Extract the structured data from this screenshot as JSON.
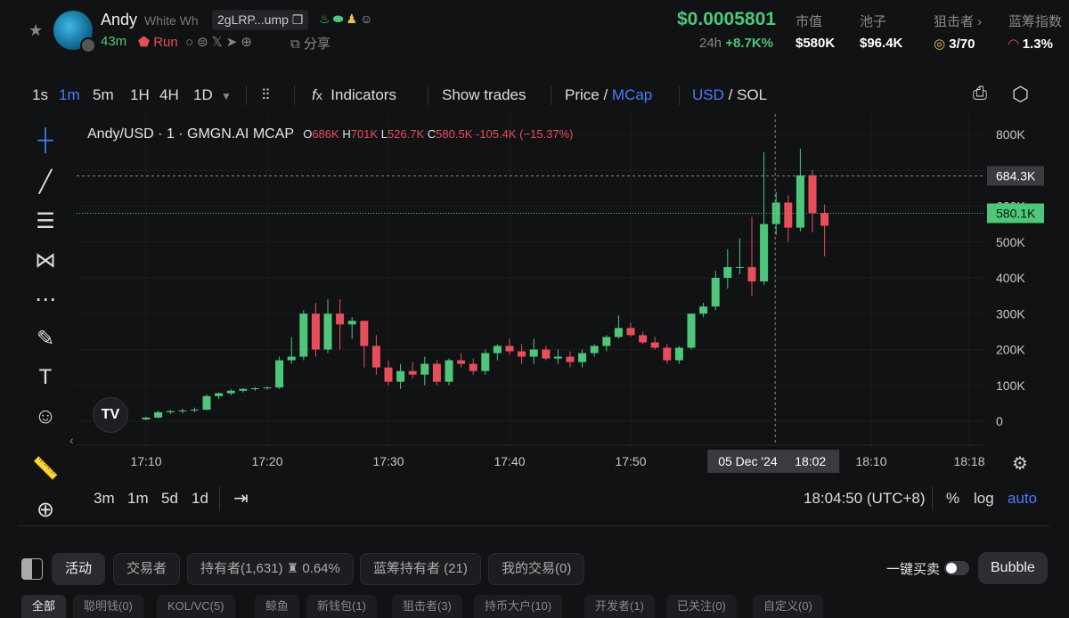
{
  "token": {
    "name": "Andy",
    "subname": "White Wh",
    "address": "2gLRP...ump",
    "age": "43m",
    "run_label": "Run",
    "share_label": "分享",
    "price": "$0.0005801",
    "change_24h_label": "24h",
    "change_24h": "+8.7K%"
  },
  "stats": [
    {
      "label": "市值",
      "value": "$580K"
    },
    {
      "label": "池子",
      "value": "$96.4K"
    },
    {
      "label": "狙击者 ›",
      "value": "3/70"
    },
    {
      "label": "蓝筹指数",
      "value": "1.3%"
    }
  ],
  "toolbar": {
    "intervals": [
      "1s",
      "1m",
      "5m",
      "1H",
      "4H",
      "1D"
    ],
    "active_interval": "1m",
    "indicators_label": "Indicators",
    "show_trades_label": "Show trades",
    "price_label": "Price",
    "mcap_label": "MCap",
    "usd_label": "USD",
    "sol_label": "SOL"
  },
  "chart_legend": {
    "symbol": "Andy/USD · 1 · GMGN.AI MCAP",
    "o_label": "O",
    "o": "686K",
    "h_label": "H",
    "h": "701K",
    "l_label": "L",
    "l": "526.7K",
    "c_label": "C",
    "c": "580.5K",
    "change": "-105.4K (−15.37%)"
  },
  "chart_data": {
    "type": "candlestick",
    "x_ticks": [
      "17:10",
      "17:20",
      "17:30",
      "17:40",
      "17:50",
      "18:10",
      "18:18"
    ],
    "y_ticks": [
      "800K",
      "700K",
      "600K",
      "500K",
      "400K",
      "300K",
      "200K",
      "100K",
      "0"
    ],
    "ylim": [
      0,
      800000
    ],
    "crosshair_price": "684.3K",
    "crosshair_time": "05 Dec '24",
    "crosshair_time_hm": "18:02",
    "last_price": "580.1K",
    "candles": [
      {
        "t": 1,
        "o": 5000,
        "h": 12000,
        "l": 3000,
        "c": 10000
      },
      {
        "t": 2,
        "o": 10000,
        "h": 30000,
        "l": 8000,
        "c": 25000
      },
      {
        "t": 3,
        "o": 25000,
        "h": 32000,
        "l": 20000,
        "c": 28000
      },
      {
        "t": 4,
        "o": 28000,
        "h": 35000,
        "l": 22000,
        "c": 30000
      },
      {
        "t": 5,
        "o": 30000,
        "h": 38000,
        "l": 25000,
        "c": 32000
      },
      {
        "t": 6,
        "o": 32000,
        "h": 75000,
        "l": 30000,
        "c": 70000
      },
      {
        "t": 7,
        "o": 70000,
        "h": 80000,
        "l": 62000,
        "c": 78000
      },
      {
        "t": 8,
        "o": 78000,
        "h": 90000,
        "l": 72000,
        "c": 85000
      },
      {
        "t": 9,
        "o": 85000,
        "h": 92000,
        "l": 80000,
        "c": 90000
      },
      {
        "t": 10,
        "o": 90000,
        "h": 95000,
        "l": 85000,
        "c": 92000
      },
      {
        "t": 11,
        "o": 92000,
        "h": 96000,
        "l": 88000,
        "c": 94000
      },
      {
        "t": 12,
        "o": 94000,
        "h": 180000,
        "l": 90000,
        "c": 170000
      },
      {
        "t": 13,
        "o": 170000,
        "h": 235000,
        "l": 160000,
        "c": 180000
      },
      {
        "t": 14,
        "o": 180000,
        "h": 310000,
        "l": 170000,
        "c": 300000
      },
      {
        "t": 15,
        "o": 300000,
        "h": 330000,
        "l": 180000,
        "c": 200000
      },
      {
        "t": 16,
        "o": 200000,
        "h": 340000,
        "l": 190000,
        "c": 300000
      },
      {
        "t": 17,
        "o": 300000,
        "h": 340000,
        "l": 200000,
        "c": 270000
      },
      {
        "t": 18,
        "o": 270000,
        "h": 290000,
        "l": 230000,
        "c": 280000
      },
      {
        "t": 19,
        "o": 280000,
        "h": 260000,
        "l": 150000,
        "c": 210000
      },
      {
        "t": 20,
        "o": 210000,
        "h": 240000,
        "l": 130000,
        "c": 150000
      },
      {
        "t": 21,
        "o": 150000,
        "h": 170000,
        "l": 100000,
        "c": 110000
      },
      {
        "t": 22,
        "o": 110000,
        "h": 160000,
        "l": 90000,
        "c": 140000
      },
      {
        "t": 23,
        "o": 140000,
        "h": 165000,
        "l": 120000,
        "c": 130000
      },
      {
        "t": 24,
        "o": 130000,
        "h": 180000,
        "l": 100000,
        "c": 160000
      },
      {
        "t": 25,
        "o": 160000,
        "h": 170000,
        "l": 100000,
        "c": 110000
      },
      {
        "t": 26,
        "o": 110000,
        "h": 175000,
        "l": 100000,
        "c": 170000
      },
      {
        "t": 27,
        "o": 170000,
        "h": 190000,
        "l": 150000,
        "c": 160000
      },
      {
        "t": 28,
        "o": 160000,
        "h": 175000,
        "l": 130000,
        "c": 140000
      },
      {
        "t": 29,
        "o": 140000,
        "h": 200000,
        "l": 130000,
        "c": 190000
      },
      {
        "t": 30,
        "o": 190000,
        "h": 215000,
        "l": 170000,
        "c": 210000
      },
      {
        "t": 31,
        "o": 210000,
        "h": 230000,
        "l": 185000,
        "c": 195000
      },
      {
        "t": 32,
        "o": 195000,
        "h": 215000,
        "l": 160000,
        "c": 180000
      },
      {
        "t": 33,
        "o": 180000,
        "h": 230000,
        "l": 160000,
        "c": 200000
      },
      {
        "t": 34,
        "o": 200000,
        "h": 210000,
        "l": 170000,
        "c": 175000
      },
      {
        "t": 35,
        "o": 175000,
        "h": 200000,
        "l": 160000,
        "c": 180000
      },
      {
        "t": 36,
        "o": 180000,
        "h": 195000,
        "l": 150000,
        "c": 165000
      },
      {
        "t": 37,
        "o": 165000,
        "h": 200000,
        "l": 150000,
        "c": 190000
      },
      {
        "t": 38,
        "o": 190000,
        "h": 215000,
        "l": 180000,
        "c": 210000
      },
      {
        "t": 39,
        "o": 210000,
        "h": 240000,
        "l": 195000,
        "c": 235000
      },
      {
        "t": 40,
        "o": 235000,
        "h": 295000,
        "l": 230000,
        "c": 260000
      },
      {
        "t": 41,
        "o": 260000,
        "h": 275000,
        "l": 235000,
        "c": 240000
      },
      {
        "t": 42,
        "o": 240000,
        "h": 250000,
        "l": 215000,
        "c": 220000
      },
      {
        "t": 43,
        "o": 220000,
        "h": 235000,
        "l": 200000,
        "c": 205000
      },
      {
        "t": 44,
        "o": 205000,
        "h": 215000,
        "l": 160000,
        "c": 170000
      },
      {
        "t": 45,
        "o": 170000,
        "h": 210000,
        "l": 160000,
        "c": 205000
      },
      {
        "t": 46,
        "o": 205000,
        "h": 300000,
        "l": 200000,
        "c": 300000
      },
      {
        "t": 47,
        "o": 300000,
        "h": 330000,
        "l": 290000,
        "c": 320000
      },
      {
        "t": 48,
        "o": 320000,
        "h": 420000,
        "l": 310000,
        "c": 400000
      },
      {
        "t": 49,
        "o": 400000,
        "h": 480000,
        "l": 370000,
        "c": 430000
      },
      {
        "t": 50,
        "o": 430000,
        "h": 510000,
        "l": 410000,
        "c": 430000
      },
      {
        "t": 51,
        "o": 430000,
        "h": 570000,
        "l": 350000,
        "c": 390000
      },
      {
        "t": 52,
        "o": 390000,
        "h": 750000,
        "l": 380000,
        "c": 550000
      },
      {
        "t": 53,
        "o": 550000,
        "h": 640000,
        "l": 520000,
        "c": 610000
      },
      {
        "t": 54,
        "o": 610000,
        "h": 630000,
        "l": 500000,
        "c": 540000
      },
      {
        "t": 55,
        "o": 540000,
        "h": 760000,
        "l": 530000,
        "c": 686000
      },
      {
        "t": 56,
        "o": 686000,
        "h": 701000,
        "l": 526700,
        "c": 580500
      },
      {
        "t": 57,
        "o": 580500,
        "h": 605000,
        "l": 460000,
        "c": 545000
      }
    ]
  },
  "left_tools": [
    "crosshair-icon",
    "trendline-icon",
    "fib-icon",
    "pattern-icon",
    "measure-lines-icon",
    "brush-icon",
    "text-icon",
    "emoji-icon",
    "ruler-icon",
    "zoom-in-icon"
  ],
  "bottom": {
    "ranges": [
      "3m",
      "1m",
      "5d",
      "1d"
    ],
    "clock": "18:04:50 (UTC+8)",
    "percent_label": "%",
    "log_label": "log",
    "auto_label": "auto"
  },
  "tabs": [
    {
      "label": "活动",
      "active": true
    },
    {
      "label": "交易者",
      "active": false
    },
    {
      "label": "持有者(1,631)",
      "extra": "0.64%",
      "active": false
    },
    {
      "label": "蓝筹持有者 (21)",
      "active": false
    },
    {
      "label": "我的交易(0)",
      "active": false
    }
  ],
  "quick_trade_label": "一键买卖",
  "bubble_label": "Bubble",
  "sub_tabs": [
    "全部",
    "聪明钱(0)",
    "KOL/VC(5)",
    "鲸鱼",
    "新钱包(1)",
    "狙击者(3)",
    "持币大户(10)",
    "开发者(1)",
    "已关注(0)",
    "自定义(0)"
  ],
  "colors": {
    "up": "#4ec77a",
    "down": "#e84d5c",
    "accent": "#4b7bff"
  }
}
